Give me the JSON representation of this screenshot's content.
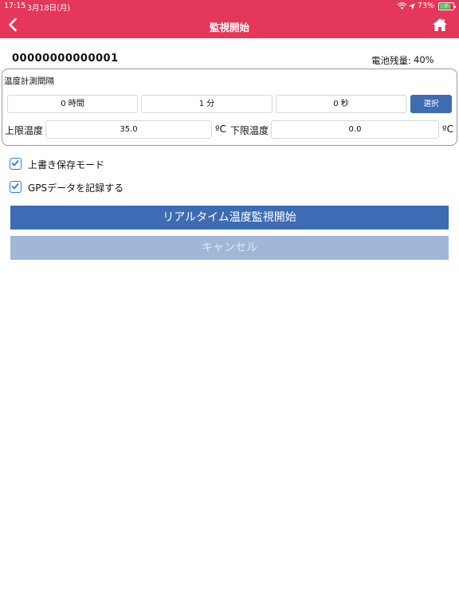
{
  "status_bar": {
    "time": "17:15",
    "date": "3月18日(月)",
    "battery_percent": "73%",
    "icons": [
      "wifi-icon",
      "location-icon",
      "battery-charging-icon"
    ]
  },
  "header": {
    "title": "監視開始",
    "background_color": "#e5375a",
    "icons": [
      "back-chevron-icon",
      "home-icon"
    ]
  },
  "device": {
    "id": "00000000000001",
    "battery_label": "電池残量:",
    "battery_value": "40%"
  },
  "interval": {
    "label": "温度計測間隔",
    "hours": "0 時間",
    "minutes": "1 分",
    "seconds": "0 秒",
    "select_label": "選択"
  },
  "thresholds": {
    "upper_label": "上限温度",
    "upper_value": "35.0",
    "upper_unit": "ºC",
    "lower_label": "下限温度",
    "lower_value": "0.0",
    "lower_unit": "ºC"
  },
  "options": [
    {
      "label": "上書き保存モード",
      "checked": true
    },
    {
      "label": "GPSデータを記録する",
      "checked": true
    }
  ],
  "actions": {
    "start_label": "リアルタイム温度監視開始",
    "cancel_label": "キャンセル",
    "accent_color": "#3e6cb3"
  }
}
